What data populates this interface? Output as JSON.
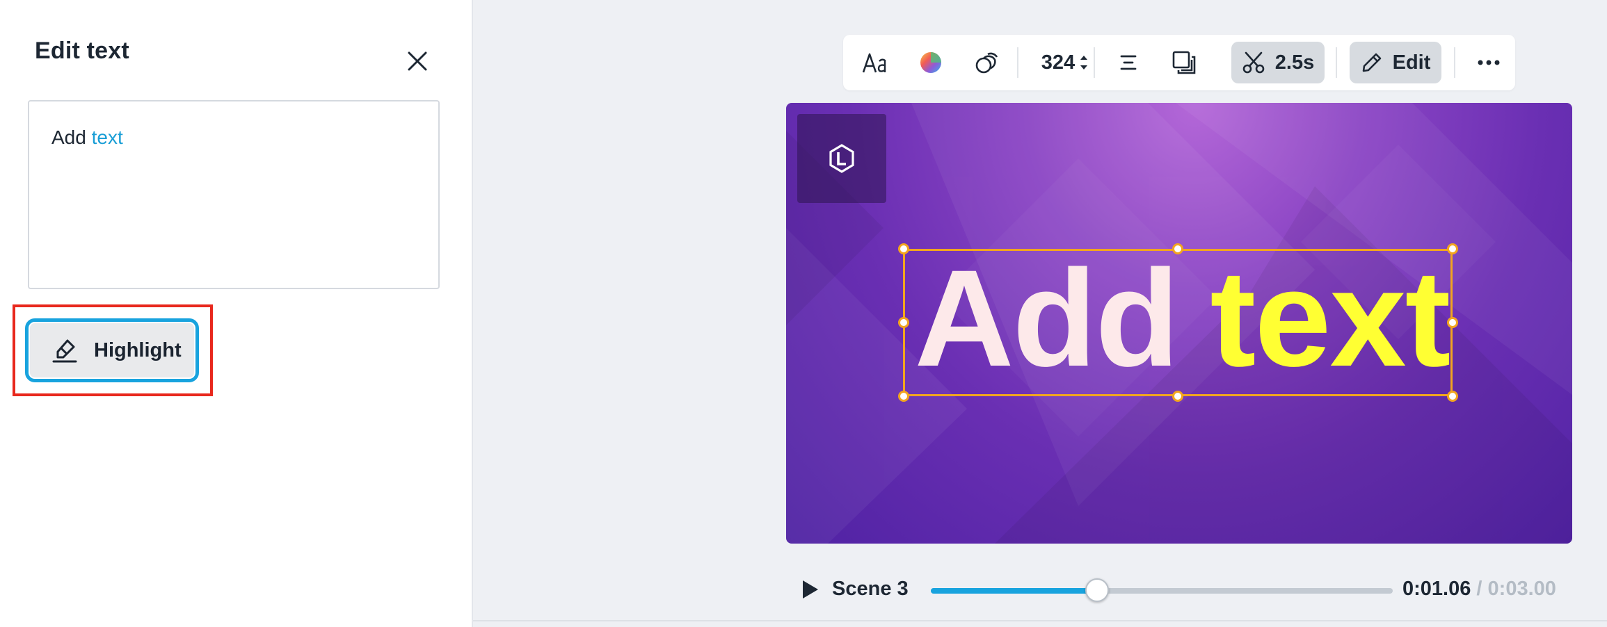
{
  "panel": {
    "title": "Edit text",
    "editor": {
      "word1": "Add",
      "word2": "text"
    },
    "highlight_label": "Highlight"
  },
  "toolbar": {
    "font_size": "324",
    "duration": "2.5s",
    "edit_label": "Edit",
    "icons": [
      "font-icon",
      "color-wheel-icon",
      "effects-icon",
      "align-icon",
      "layer-icon",
      "scissors-icon",
      "pencil-icon",
      "more-icon"
    ]
  },
  "canvas": {
    "text_word1": "Add",
    "text_word2": "text",
    "colors": {
      "word1": "#fde9ea",
      "word2": "#ffff33",
      "selection": "#f2a51f",
      "accent": "#18a3de"
    }
  },
  "playback": {
    "scene_label": "Scene 3",
    "current_time": "0:01.06",
    "total_time": "/ 0:03.00",
    "progress": 0.36
  }
}
